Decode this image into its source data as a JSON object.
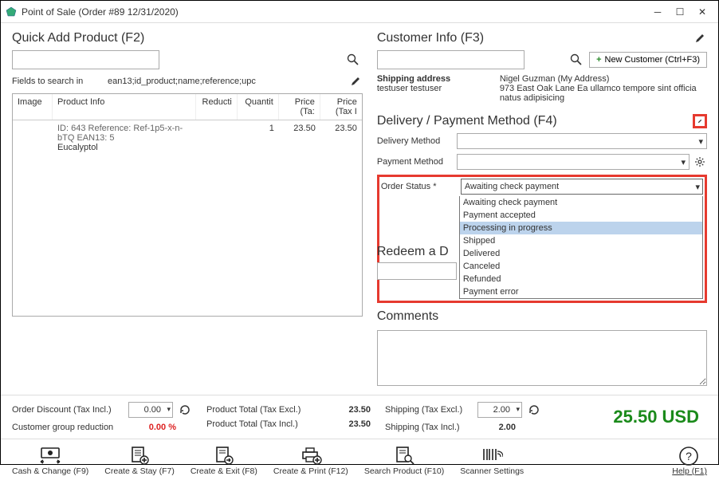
{
  "title": "Point of Sale (Order #89 12/31/2020)",
  "quick_add": {
    "heading": "Quick Add Product (F2)",
    "fields_label": "Fields to search in",
    "fields_value": "ean13;id_product;name;reference;upc"
  },
  "grid": {
    "headers": {
      "image": "Image",
      "product_info": "Product Info",
      "reducti": "Reducti",
      "quantit": "Quantit",
      "price_excl": "Price (Ta:",
      "price_incl": "Price (Tax I"
    },
    "row": {
      "ref_line": "ID: 643 Reference: Ref-1p5-x-n-bTQ EAN13: 5",
      "name": "Eucalyptol",
      "qty": "1",
      "price_excl": "23.50",
      "price_incl": "23.50"
    }
  },
  "customer": {
    "heading": "Customer Info (F3)",
    "new_btn": "New Customer (Ctrl+F3)",
    "shipping_label": "Shipping address",
    "tester": "testuser testuser",
    "name": "Nigel Guzman (My Address)",
    "addr": "973 East Oak Lane Ea ullamco tempore sint officia natus adipisicing"
  },
  "delivery": {
    "heading": "Delivery / Payment Method (F4)",
    "dm_label": "Delivery Method",
    "pm_label": "Payment Method",
    "os_label": "Order Status *",
    "os_value": "Awaiting check payment",
    "options": [
      "Awaiting check payment",
      "Payment accepted",
      "Processing in progress",
      "Shipped",
      "Delivered",
      "Canceled",
      "Refunded",
      "Payment error"
    ]
  },
  "redeem": {
    "heading": "Redeem a D"
  },
  "comments": {
    "heading": "Comments"
  },
  "totals": {
    "order_discount_label": "Order Discount (Tax Incl.)",
    "order_discount_value": "0.00",
    "cgr_label": "Customer group reduction",
    "cgr_value": "0.00 %",
    "pt_excl_label": "Product Total (Tax Excl.)",
    "pt_excl_value": "23.50",
    "pt_incl_label": "Product Total (Tax Incl.)",
    "pt_incl_value": "23.50",
    "ship_excl_label": "Shipping (Tax Excl.)",
    "ship_excl_value": "2.00",
    "ship_incl_label": "Shipping (Tax Incl.)",
    "ship_incl_value": "2.00",
    "grand": "25.50 USD"
  },
  "footer": {
    "cash": "Cash & Change (F9)",
    "stay": "Create & Stay (F7)",
    "exit": "Create & Exit (F8)",
    "print": "Create & Print (F12)",
    "search": "Search Product (F10)",
    "scanner": "Scanner Settings",
    "help": "Help (F1)"
  }
}
